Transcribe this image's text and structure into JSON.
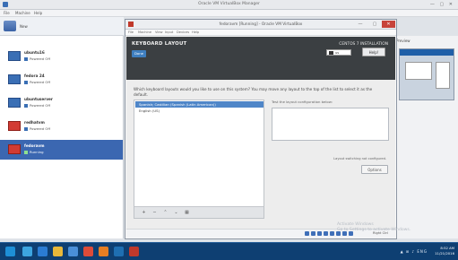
{
  "manager": {
    "title": "Oracle VM VirtualBox Manager",
    "menu": [
      "File",
      "Machine",
      "Help"
    ],
    "toolbar_label": "New",
    "vms": [
      {
        "name": "ubuntu16",
        "state": "Powered Off"
      },
      {
        "name": "fedora 24",
        "state": "Powered Off"
      },
      {
        "name": "ubuntuserver",
        "state": "Powered Off"
      },
      {
        "name": "redhatvm",
        "state": "Powered Off"
      },
      {
        "name": "fedoravm",
        "state": "Running"
      }
    ],
    "right_panel_title": "Preview"
  },
  "vm_window": {
    "title": "fedoravm [Running] - Oracle VM VirtualBox",
    "menu": [
      "File",
      "Machine",
      "View",
      "Input",
      "Devices",
      "Help"
    ]
  },
  "installer": {
    "header_title": "KEYBOARD LAYOUT",
    "done_label": "Done",
    "install_title": "CENTOS 7 INSTALLATION",
    "lang_code": "us",
    "help_label": "Help!",
    "question": "Which keyboard layouts would you like to use on this system? You may move any layout to the top of the list to select it as the default.",
    "layouts": [
      "Spanish; Castilian (Spanish (Latin American))",
      "English (US)"
    ],
    "list_buttons": [
      "+",
      "−",
      "⌃",
      "⌄",
      "▦"
    ],
    "test_label": "Test the layout configuration below:",
    "layout_note": "Layout switching not configured.",
    "options_label": "Options"
  },
  "status": {
    "host_key": "Right Ctrl"
  },
  "watermark": [
    "Activate Windows",
    "Go to Settings to activate Windows."
  ],
  "taskbar": {
    "tray": "▲ ⊞ ♪ ENG",
    "time": "8:52 AM",
    "date": "11/21/2016"
  }
}
